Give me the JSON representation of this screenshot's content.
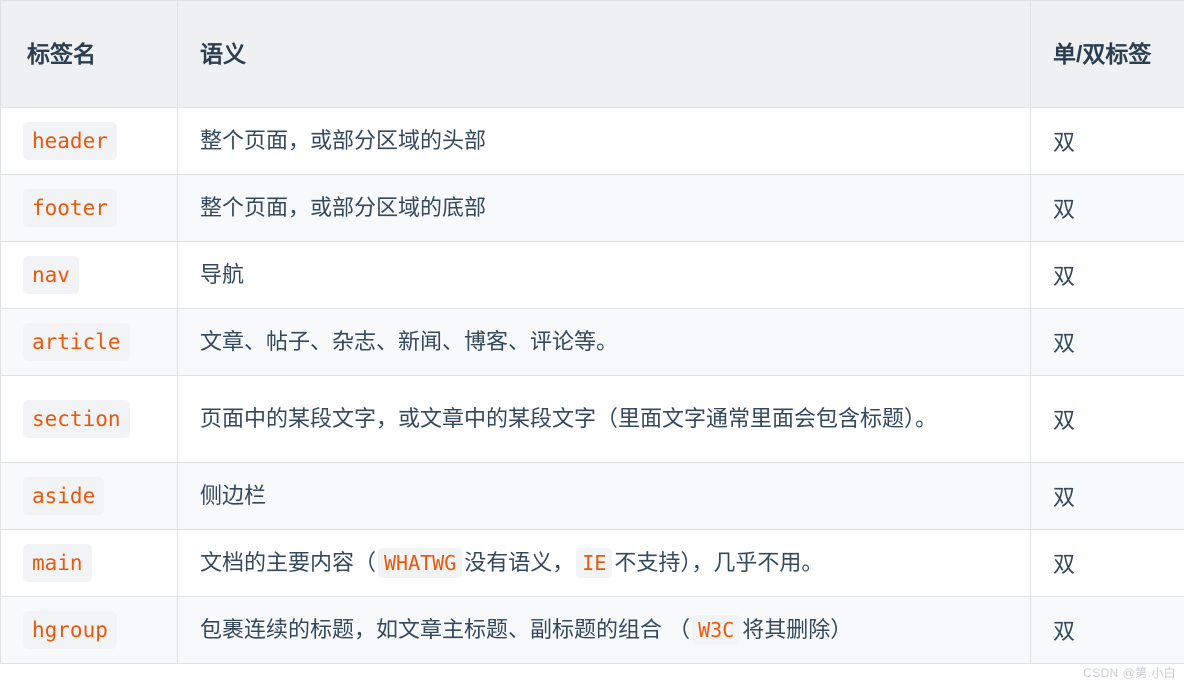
{
  "table": {
    "columns": [
      {
        "key": "tag",
        "label": "标签名"
      },
      {
        "key": "sem",
        "label": "语义"
      },
      {
        "key": "pair",
        "label": "单/双标签"
      }
    ],
    "rows": [
      {
        "tag": "header",
        "semantic_parts": [
          {
            "type": "text",
            "value": "整个页面，或部分区域的头部"
          }
        ],
        "pair": "双"
      },
      {
        "tag": "footer",
        "semantic_parts": [
          {
            "type": "text",
            "value": "整个页面，或部分区域的底部"
          }
        ],
        "pair": "双"
      },
      {
        "tag": "nav",
        "semantic_parts": [
          {
            "type": "text",
            "value": "导航"
          }
        ],
        "pair": "双"
      },
      {
        "tag": "article",
        "semantic_parts": [
          {
            "type": "text",
            "value": "文章、帖子、杂志、新闻、博客、评论等。"
          }
        ],
        "pair": "双"
      },
      {
        "tag": "section",
        "semantic_parts": [
          {
            "type": "text",
            "value": "页面中的某段文字，或文章中的某段文字（里面文字通常里面会包含标题）。"
          }
        ],
        "pair": "双",
        "tall": true
      },
      {
        "tag": "aside",
        "semantic_parts": [
          {
            "type": "text",
            "value": "侧边栏"
          }
        ],
        "pair": "双"
      },
      {
        "tag": "main",
        "semantic_parts": [
          {
            "type": "text",
            "value": "文档的主要内容（"
          },
          {
            "type": "code",
            "value": "WHATWG"
          },
          {
            "type": "text",
            "value": "没有语义，"
          },
          {
            "type": "code",
            "value": "IE"
          },
          {
            "type": "text",
            "value": "不支持），几乎不用。"
          }
        ],
        "pair": "双"
      },
      {
        "tag": "hgroup",
        "semantic_parts": [
          {
            "type": "text",
            "value": "包裹连续的标题，如文章主标题、副标题的组合 （"
          },
          {
            "type": "code",
            "value": "W3C"
          },
          {
            "type": "text",
            "value": "将其删除）"
          }
        ],
        "pair": "双"
      }
    ]
  },
  "watermark": {
    "text": "CSDN @第.小白"
  },
  "colors": {
    "code_text": "#e8590c",
    "code_bg": "#f2f3f5",
    "header_bg": "#eef0f2",
    "header_text": "#2c3e50",
    "body_text": "#34495e",
    "border": "#dfe2e5",
    "stripe_bg": "#f8f9fa"
  }
}
